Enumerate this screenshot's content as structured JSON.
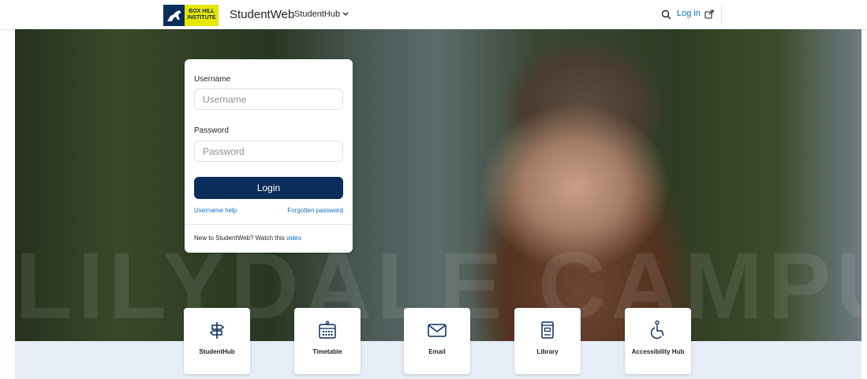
{
  "nav": {
    "logo_line1": "BOX HILL",
    "logo_line2": "INSTITUTE",
    "brand": "StudentWeb",
    "menu_label": "StudentHub",
    "login_label": "Log in"
  },
  "hero": {
    "watermark": "LILYDALE CAMPUS"
  },
  "login": {
    "username_label": "Username",
    "username_placeholder": "Username",
    "password_label": "Password",
    "password_placeholder": "Password",
    "button_label": "Login",
    "username_help": "Username help",
    "forgotten_password": "Forgotten password",
    "new_text": "New to StudentWeb? Watch this ",
    "video_link": "video"
  },
  "tiles": [
    {
      "label": "StudentHub",
      "icon": "signpost-icon"
    },
    {
      "label": "Timetable",
      "icon": "calendar-icon"
    },
    {
      "label": "Email",
      "icon": "envelope-icon"
    },
    {
      "label": "Library",
      "icon": "book-icon"
    },
    {
      "label": "Accessibility Hub",
      "icon": "accessibility-icon"
    }
  ],
  "colors": {
    "navy": "#0a2d5b",
    "link": "#0f6cbf",
    "band": "#e6edf7",
    "logo_yellow": "#e6e600"
  }
}
